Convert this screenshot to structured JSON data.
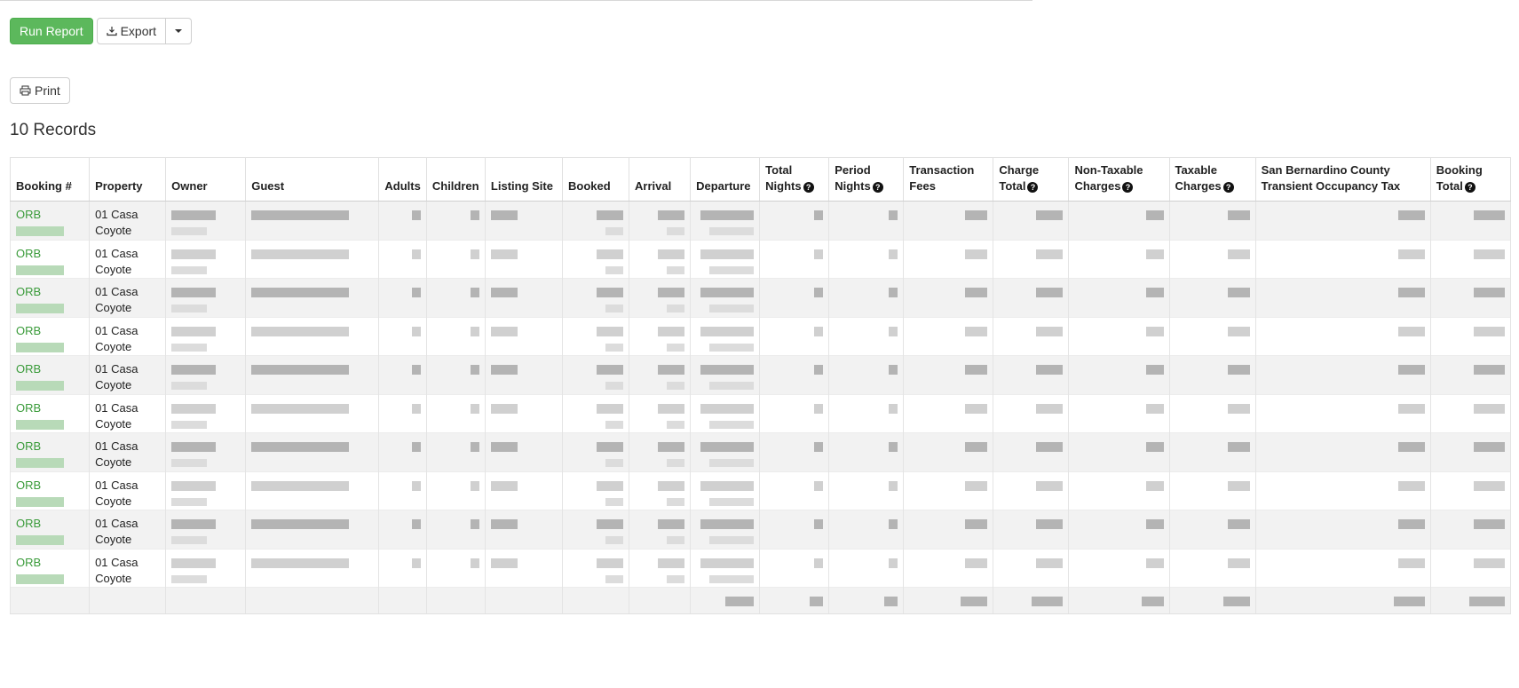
{
  "toolbar": {
    "run_report_label": "Run Report",
    "export_label": "Export",
    "print_label": "Print"
  },
  "records_label": "10 Records",
  "colors": {
    "accent_green": "#5cb85c",
    "link_green": "#3a9b3a"
  },
  "table": {
    "columns": [
      {
        "line1": "Booking #",
        "line2": "",
        "help": false
      },
      {
        "line1": "Property",
        "line2": "",
        "help": false
      },
      {
        "line1": "Owner",
        "line2": "",
        "help": false
      },
      {
        "line1": "Guest",
        "line2": "",
        "help": false
      },
      {
        "line1": "Adults",
        "line2": "",
        "help": false
      },
      {
        "line1": "Children",
        "line2": "",
        "help": false
      },
      {
        "line1": "Listing Site",
        "line2": "",
        "help": false
      },
      {
        "line1": "Booked",
        "line2": "",
        "help": false
      },
      {
        "line1": "Arrival",
        "line2": "",
        "help": false
      },
      {
        "line1": "Departure",
        "line2": "",
        "help": false
      },
      {
        "line1": "Total",
        "line2": "Nights",
        "help": true
      },
      {
        "line1": "Period",
        "line2": "Nights",
        "help": true
      },
      {
        "line1": "Transaction",
        "line2": "Fees",
        "help": false
      },
      {
        "line1": "Charge",
        "line2": "Total",
        "help": true
      },
      {
        "line1": "Non-Taxable",
        "line2": "Charges",
        "help": true
      },
      {
        "line1": "Taxable",
        "line2": "Charges",
        "help": true
      },
      {
        "line1": "San Bernardino County",
        "line2": "Transient Occupancy Tax",
        "help": false
      },
      {
        "line1": "Booking",
        "line2": "Total",
        "help": true
      }
    ],
    "rows": [
      {
        "booking": "ORB",
        "property_line1": "01 Casa",
        "property_line2": "Coyote"
      },
      {
        "booking": "ORB",
        "property_line1": "01 Casa",
        "property_line2": "Coyote"
      },
      {
        "booking": "ORB",
        "property_line1": "01 Casa",
        "property_line2": "Coyote"
      },
      {
        "booking": "ORB",
        "property_line1": "01 Casa",
        "property_line2": "Coyote"
      },
      {
        "booking": "ORB",
        "property_line1": "01 Casa",
        "property_line2": "Coyote"
      },
      {
        "booking": "ORB",
        "property_line1": "01 Casa",
        "property_line2": "Coyote"
      },
      {
        "booking": "ORB",
        "property_line1": "01 Casa",
        "property_line2": "Coyote"
      },
      {
        "booking": "ORB",
        "property_line1": "01 Casa",
        "property_line2": "Coyote"
      },
      {
        "booking": "ORB",
        "property_line1": "01 Casa",
        "property_line2": "Coyote"
      },
      {
        "booking": "ORB",
        "property_line1": "01 Casa",
        "property_line2": "Coyote"
      }
    ]
  }
}
